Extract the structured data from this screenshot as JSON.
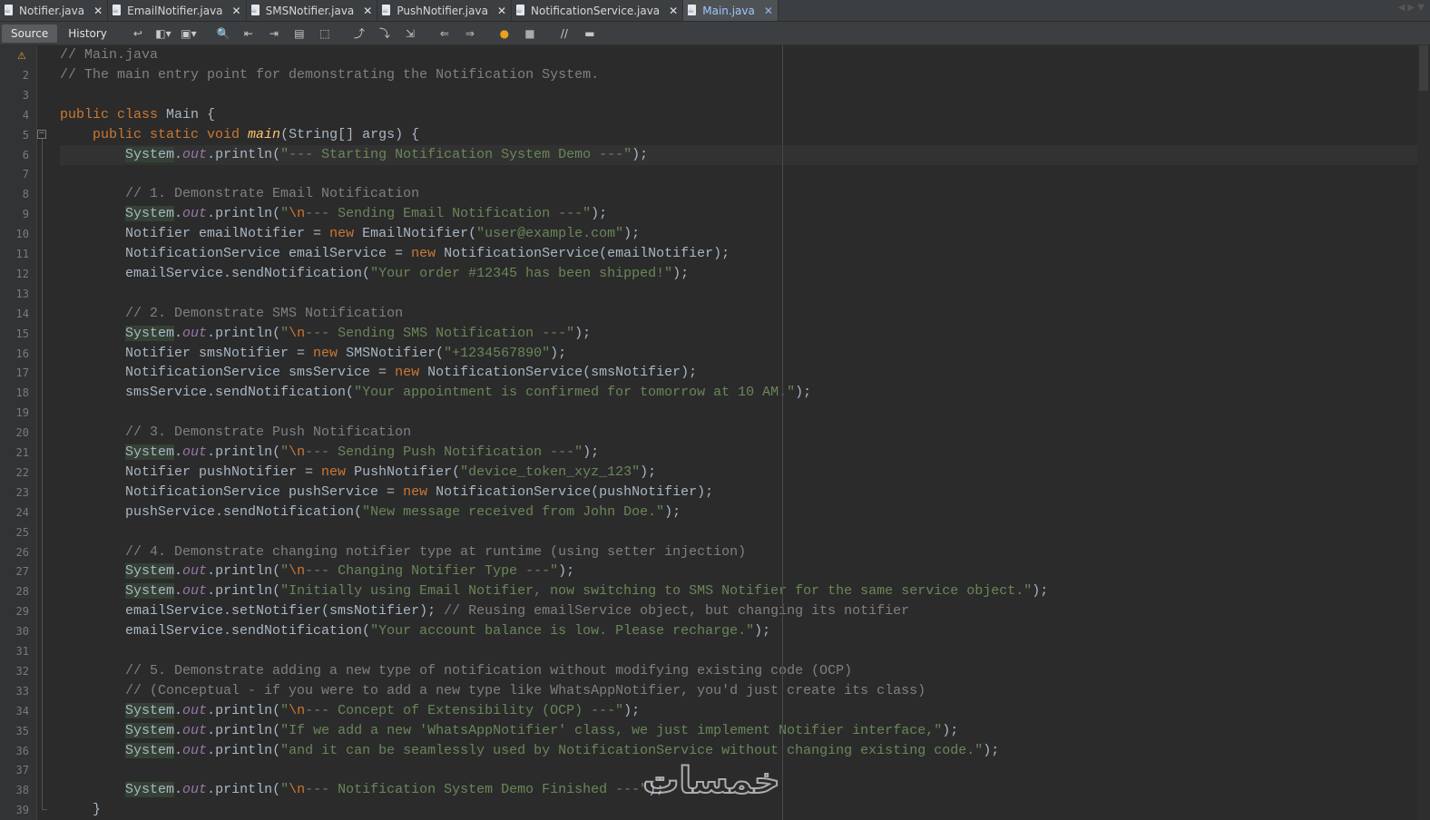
{
  "tabs": [
    {
      "label": "Notifier.java",
      "active": false
    },
    {
      "label": "EmailNotifier.java",
      "active": false
    },
    {
      "label": "SMSNotifier.java",
      "active": false
    },
    {
      "label": "PushNotifier.java",
      "active": false
    },
    {
      "label": "NotificationService.java",
      "active": false
    },
    {
      "label": "Main.java",
      "active": true
    }
  ],
  "toolbar": {
    "source_label": "Source",
    "history_label": "History"
  },
  "editor": {
    "line_numbers": [
      "",
      "2",
      "3",
      "4",
      "5",
      "6",
      "7",
      "8",
      "9",
      "10",
      "11",
      "12",
      "13",
      "14",
      "15",
      "16",
      "17",
      "18",
      "19",
      "20",
      "21",
      "22",
      "23",
      "24",
      "25",
      "26",
      "27",
      "28",
      "29",
      "30",
      "31",
      "32",
      "33",
      "34",
      "35",
      "36",
      "37",
      "38",
      "39"
    ],
    "lines": [
      [
        {
          "t": "// Main.java",
          "c": "c"
        }
      ],
      [
        {
          "t": "// The main entry point for demonstrating the Notification System.",
          "c": "c"
        }
      ],
      [],
      [
        {
          "t": "public class ",
          "c": "k"
        },
        {
          "t": "Main {",
          "c": ""
        }
      ],
      [
        {
          "t": "    "
        },
        {
          "t": "public static void ",
          "c": "k"
        },
        {
          "t": "main",
          "c": "m"
        },
        {
          "t": "(String[] args) {",
          "c": ""
        }
      ],
      [
        {
          "t": "        "
        },
        {
          "t": "System",
          "c": "sys"
        },
        {
          "t": "."
        },
        {
          "t": "out",
          "c": "f"
        },
        {
          "t": ".println("
        },
        {
          "t": "\"--- Starting Notification System Demo ---\"",
          "c": "s"
        },
        {
          "t": ");"
        }
      ],
      [],
      [
        {
          "t": "        "
        },
        {
          "t": "// 1. Demonstrate Email Notification",
          "c": "c"
        }
      ],
      [
        {
          "t": "        "
        },
        {
          "t": "System",
          "c": "sys"
        },
        {
          "t": "."
        },
        {
          "t": "out",
          "c": "f"
        },
        {
          "t": ".println("
        },
        {
          "t": "\"",
          "c": "s"
        },
        {
          "t": "\\n",
          "c": "e"
        },
        {
          "t": "--- Sending Email Notification ---\"",
          "c": "s"
        },
        {
          "t": ");"
        }
      ],
      [
        {
          "t": "        Notifier emailNotifier = "
        },
        {
          "t": "new ",
          "c": "k"
        },
        {
          "t": "EmailNotifier("
        },
        {
          "t": "\"user@example.com\"",
          "c": "s"
        },
        {
          "t": ");"
        }
      ],
      [
        {
          "t": "        NotificationService emailService = "
        },
        {
          "t": "new ",
          "c": "k"
        },
        {
          "t": "NotificationService(emailNotifier);"
        }
      ],
      [
        {
          "t": "        emailService.sendNotification("
        },
        {
          "t": "\"Your order #12345 has been shipped!\"",
          "c": "s"
        },
        {
          "t": ");"
        }
      ],
      [],
      [
        {
          "t": "        "
        },
        {
          "t": "// 2. Demonstrate SMS Notification",
          "c": "c"
        }
      ],
      [
        {
          "t": "        "
        },
        {
          "t": "System",
          "c": "sys"
        },
        {
          "t": "."
        },
        {
          "t": "out",
          "c": "f"
        },
        {
          "t": ".println("
        },
        {
          "t": "\"",
          "c": "s"
        },
        {
          "t": "\\n",
          "c": "e"
        },
        {
          "t": "--- Sending SMS Notification ---\"",
          "c": "s"
        },
        {
          "t": ");"
        }
      ],
      [
        {
          "t": "        Notifier smsNotifier = "
        },
        {
          "t": "new ",
          "c": "k"
        },
        {
          "t": "SMSNotifier("
        },
        {
          "t": "\"+1234567890\"",
          "c": "s"
        },
        {
          "t": ");"
        }
      ],
      [
        {
          "t": "        NotificationService smsService = "
        },
        {
          "t": "new ",
          "c": "k"
        },
        {
          "t": "NotificationService(smsNotifier);"
        }
      ],
      [
        {
          "t": "        smsService.sendNotification("
        },
        {
          "t": "\"Your appointment is confirmed for tomorrow at 10 AM.\"",
          "c": "s"
        },
        {
          "t": ");"
        }
      ],
      [],
      [
        {
          "t": "        "
        },
        {
          "t": "// 3. Demonstrate Push Notification",
          "c": "c"
        }
      ],
      [
        {
          "t": "        "
        },
        {
          "t": "System",
          "c": "sys"
        },
        {
          "t": "."
        },
        {
          "t": "out",
          "c": "f"
        },
        {
          "t": ".println("
        },
        {
          "t": "\"",
          "c": "s"
        },
        {
          "t": "\\n",
          "c": "e"
        },
        {
          "t": "--- Sending Push Notification ---\"",
          "c": "s"
        },
        {
          "t": ");"
        }
      ],
      [
        {
          "t": "        Notifier pushNotifier = "
        },
        {
          "t": "new ",
          "c": "k"
        },
        {
          "t": "PushNotifier("
        },
        {
          "t": "\"device_token_xyz_123\"",
          "c": "s"
        },
        {
          "t": ");"
        }
      ],
      [
        {
          "t": "        NotificationService pushService = "
        },
        {
          "t": "new ",
          "c": "k"
        },
        {
          "t": "NotificationService(pushNotifier);"
        }
      ],
      [
        {
          "t": "        pushService.sendNotification("
        },
        {
          "t": "\"New message received from John Doe.\"",
          "c": "s"
        },
        {
          "t": ");"
        }
      ],
      [],
      [
        {
          "t": "        "
        },
        {
          "t": "// 4. Demonstrate changing notifier type at runtime (using setter injection)",
          "c": "c"
        }
      ],
      [
        {
          "t": "        "
        },
        {
          "t": "System",
          "c": "sys"
        },
        {
          "t": "."
        },
        {
          "t": "out",
          "c": "f"
        },
        {
          "t": ".println("
        },
        {
          "t": "\"",
          "c": "s"
        },
        {
          "t": "\\n",
          "c": "e"
        },
        {
          "t": "--- Changing Notifier Type ---\"",
          "c": "s"
        },
        {
          "t": ");"
        }
      ],
      [
        {
          "t": "        "
        },
        {
          "t": "System",
          "c": "sys"
        },
        {
          "t": "."
        },
        {
          "t": "out",
          "c": "f"
        },
        {
          "t": ".println("
        },
        {
          "t": "\"Initially using Email Notifier, now switching to SMS Notifier for the same service object.\"",
          "c": "s"
        },
        {
          "t": ");"
        }
      ],
      [
        {
          "t": "        emailService.setNotifier(smsNotifier); "
        },
        {
          "t": "// Reusing emailService object, but changing its notifier",
          "c": "c"
        }
      ],
      [
        {
          "t": "        emailService.sendNotification("
        },
        {
          "t": "\"Your account balance is low. Please recharge.\"",
          "c": "s"
        },
        {
          "t": ");"
        }
      ],
      [],
      [
        {
          "t": "        "
        },
        {
          "t": "// 5. Demonstrate adding a new type of notification without modifying existing code (OCP)",
          "c": "c"
        }
      ],
      [
        {
          "t": "        "
        },
        {
          "t": "// (Conceptual - if you were to add a new type like WhatsAppNotifier, you'd just create its class)",
          "c": "c"
        }
      ],
      [
        {
          "t": "        "
        },
        {
          "t": "System",
          "c": "sys"
        },
        {
          "t": "."
        },
        {
          "t": "out",
          "c": "f"
        },
        {
          "t": ".println("
        },
        {
          "t": "\"",
          "c": "s"
        },
        {
          "t": "\\n",
          "c": "e"
        },
        {
          "t": "--- Concept of Extensibility (OCP) ---\"",
          "c": "s"
        },
        {
          "t": ");"
        }
      ],
      [
        {
          "t": "        "
        },
        {
          "t": "System",
          "c": "sys"
        },
        {
          "t": "."
        },
        {
          "t": "out",
          "c": "f"
        },
        {
          "t": ".println("
        },
        {
          "t": "\"If we add a new 'WhatsAppNotifier' class, we just implement Notifier interface,\"",
          "c": "s"
        },
        {
          "t": ");"
        }
      ],
      [
        {
          "t": "        "
        },
        {
          "t": "System",
          "c": "sys"
        },
        {
          "t": "."
        },
        {
          "t": "out",
          "c": "f"
        },
        {
          "t": ".println("
        },
        {
          "t": "\"and it can be seamlessly used by NotificationService without changing existing code.\"",
          "c": "s"
        },
        {
          "t": ");"
        }
      ],
      [],
      [
        {
          "t": "        "
        },
        {
          "t": "System",
          "c": "sys"
        },
        {
          "t": "."
        },
        {
          "t": "out",
          "c": "f"
        },
        {
          "t": ".println("
        },
        {
          "t": "\"",
          "c": "s"
        },
        {
          "t": "\\n",
          "c": "e"
        },
        {
          "t": "--- Notification System Demo Finished ---\"",
          "c": "s"
        },
        {
          "t": ");"
        }
      ],
      [
        {
          "t": "    }"
        }
      ]
    ]
  },
  "watermark": {
    "text": "خمسات"
  }
}
